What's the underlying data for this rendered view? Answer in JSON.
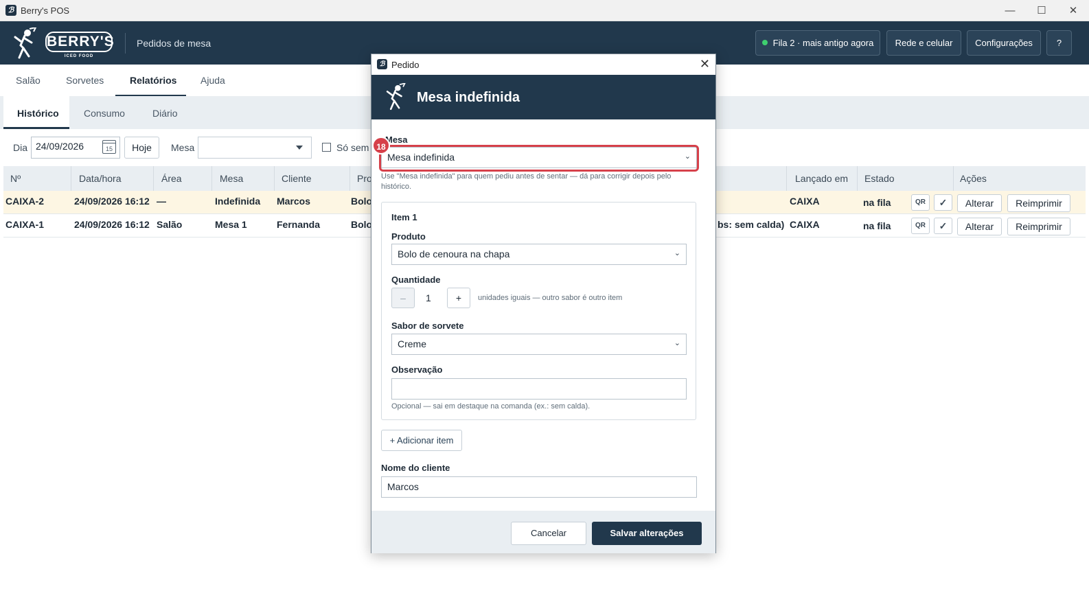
{
  "window": {
    "title": "Berry's POS",
    "controls": {
      "minimize": "—",
      "maximize": "☐",
      "close": "✕"
    }
  },
  "header": {
    "logo_text": "BERRY'S",
    "logo_sub": "ICED FOOD",
    "page_title": "Pedidos de mesa",
    "queue_status": "Fila 2 · mais antigo agora",
    "network_button": "Rede e celular",
    "settings_button": "Configurações",
    "help_button": "?"
  },
  "main_tabs": [
    "Salão",
    "Sorvetes",
    "Relatórios",
    "Ajuda"
  ],
  "sub_tabs": [
    "Histórico",
    "Consumo",
    "Diário"
  ],
  "filters": {
    "day_label": "Dia",
    "day_value": "24/09/2026",
    "calendar_day": "15",
    "today_button": "Hoje",
    "table_label": "Mesa",
    "only_without_label": "Só sem"
  },
  "table": {
    "columns": [
      "Nº",
      "Data/hora",
      "Área",
      "Mesa",
      "Cliente",
      "Pro",
      "Lançado em",
      "Estado",
      "Ações"
    ],
    "rows": [
      {
        "num": "CAIXA-2",
        "datetime": "24/09/2026 16:12",
        "area": "—",
        "table": "Indefinida",
        "client": "Marcos",
        "product": "Bolo",
        "extra": "",
        "launched": "CAIXA",
        "state": "na fila"
      },
      {
        "num": "CAIXA-1",
        "datetime": "24/09/2026 16:12",
        "area": "Salão",
        "table": "Mesa 1",
        "client": "Fernanda",
        "product": "Bolo",
        "extra": "bs: sem calda)",
        "launched": "CAIXA",
        "state": "na fila"
      }
    ],
    "actions": {
      "qr": "QR",
      "check": "✓",
      "edit": "Alterar",
      "reprint": "Reimprimir"
    }
  },
  "dialog": {
    "window_title": "Pedido",
    "heading": "Mesa indefinida",
    "mesa_label": "Mesa",
    "mesa_value": "Mesa indefinida",
    "mesa_hint": "Use \"Mesa indefinida\" para quem pediu antes de sentar — dá para corrigir depois pelo histórico.",
    "badge": "18",
    "item_title": "Item 1",
    "product_label": "Produto",
    "product_value": "Bolo de cenoura na chapa",
    "quantity_label": "Quantidade",
    "quantity_value": "1",
    "quantity_minus": "–",
    "quantity_plus": "+",
    "quantity_hint": "unidades iguais — outro sabor é outro item",
    "flavor_label": "Sabor de sorvete",
    "flavor_value": "Creme",
    "note_label": "Observação",
    "note_value": "",
    "note_hint": "Opcional — sai em destaque na comanda (ex.: sem calda).",
    "add_item": "+ Adicionar item",
    "client_label": "Nome do cliente",
    "client_value": "Marcos",
    "cancel": "Cancelar",
    "save": "Salvar alterações"
  }
}
